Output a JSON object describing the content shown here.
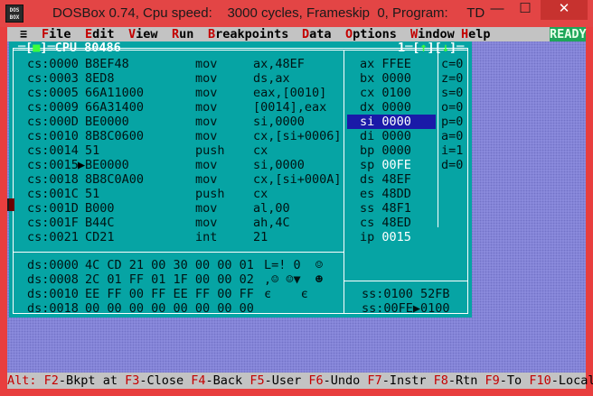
{
  "window": {
    "title": "DOSBox 0.74, Cpu speed:    3000 cycles, Frameskip  0, Program:     TD",
    "icon_label": "DOS BOX",
    "min_glyph": "—",
    "max_glyph": "☐",
    "close_glyph": "✕"
  },
  "menubar": {
    "sys": "≡",
    "items": [
      {
        "hk": "F",
        "rest": "ile"
      },
      {
        "hk": "E",
        "rest": "dit"
      },
      {
        "hk": "V",
        "rest": "iew"
      },
      {
        "hk": "R",
        "rest": "un"
      },
      {
        "hk": "B",
        "rest": "reakpoints"
      },
      {
        "hk": "D",
        "rest": "ata"
      },
      {
        "hk": "O",
        "rest": "ptions"
      },
      {
        "hk": "W",
        "rest": "indow"
      },
      {
        "hk": "H",
        "rest": "elp"
      }
    ],
    "status": "READY"
  },
  "cpu": {
    "title_left": "═[",
    "title_mark": "■",
    "title_mid": "]═CPU 80486",
    "title_right": "1═[",
    "title_up": "↑",
    "title_sep": "][",
    "title_down": "↓",
    "title_end": "]═",
    "code": [
      {
        "addr": "cs:0000",
        "ptr": " ",
        "bytes": "B8EF48",
        "mn": "mov",
        "op": "ax,48EF"
      },
      {
        "addr": "cs:0003",
        "ptr": " ",
        "bytes": "8ED8",
        "mn": "mov",
        "op": "ds,ax"
      },
      {
        "addr": "cs:0005",
        "ptr": " ",
        "bytes": "66A11000",
        "mn": "mov",
        "op": "eax,[0010]"
      },
      {
        "addr": "cs:0009",
        "ptr": " ",
        "bytes": "66A31400",
        "mn": "mov",
        "op": "[0014],eax"
      },
      {
        "addr": "cs:000D",
        "ptr": " ",
        "bytes": "BE0000",
        "mn": "mov",
        "op": "si,0000"
      },
      {
        "addr": "cs:0010",
        "ptr": " ",
        "bytes": "8B8C0600",
        "mn": "mov",
        "op": "cx,[si+0006]"
      },
      {
        "addr": "cs:0014",
        "ptr": " ",
        "bytes": "51",
        "mn": "push",
        "op": "cx"
      },
      {
        "addr": "cs:0015",
        "ptr": "▶",
        "bytes": "BE0000",
        "mn": "mov",
        "op": "si,0000"
      },
      {
        "addr": "cs:0018",
        "ptr": " ",
        "bytes": "8B8C0A00",
        "mn": "mov",
        "op": "cx,[si+000A]"
      },
      {
        "addr": "cs:001C",
        "ptr": " ",
        "bytes": "51",
        "mn": "push",
        "op": "cx"
      },
      {
        "addr": "cs:001D",
        "ptr": " ",
        "bytes": "B000",
        "mn": "mov",
        "op": "al,00"
      },
      {
        "addr": "cs:001F",
        "ptr": " ",
        "bytes": "B44C",
        "mn": "mov",
        "op": "ah,4C"
      },
      {
        "addr": "cs:0021",
        "ptr": " ",
        "bytes": "CD21",
        "mn": "int",
        "op": "21"
      }
    ],
    "registers": [
      {
        "name": "ax",
        "value": "FFEE"
      },
      {
        "name": "bx",
        "value": "0000"
      },
      {
        "name": "cx",
        "value": "0100"
      },
      {
        "name": "dx",
        "value": "0000"
      },
      {
        "name": "si",
        "value": "0000",
        "selected": true
      },
      {
        "name": "di",
        "value": "0000"
      },
      {
        "name": "bp",
        "value": "0000"
      },
      {
        "name": "sp",
        "value": "00FE"
      },
      {
        "name": "ds",
        "value": "48EF"
      },
      {
        "name": "es",
        "value": "48DD"
      },
      {
        "name": "ss",
        "value": "48F1"
      },
      {
        "name": "cs",
        "value": "48ED"
      },
      {
        "name": "ip",
        "value": "0015"
      }
    ],
    "flags": [
      {
        "name": "c",
        "value": "0"
      },
      {
        "name": "z",
        "value": "0"
      },
      {
        "name": "s",
        "value": "0"
      },
      {
        "name": "o",
        "value": "0"
      },
      {
        "name": "p",
        "value": "0"
      },
      {
        "name": "a",
        "value": "0"
      },
      {
        "name": "i",
        "value": "1"
      },
      {
        "name": "d",
        "value": "0"
      }
    ],
    "dump": [
      {
        "addr": "ds:0000",
        "bytes": "4C CD 21 00 30 00 00 01",
        "ascii": "L=! 0  ☺"
      },
      {
        "addr": "ds:0008",
        "bytes": "2C 01 FF 01 1F 00 00 02",
        "ascii": ",☺ ☺▼  ☻"
      },
      {
        "addr": "ds:0010",
        "bytes": "EE FF 00 FF EE FF 00 FF",
        "ascii": "є    є"
      },
      {
        "addr": "ds:0018",
        "bytes": "00 00 00 00 00 00 00 00",
        "ascii": ""
      }
    ],
    "stack": [
      {
        "addr": "ss:0100",
        "ptr": " ",
        "value": "52FB"
      },
      {
        "addr": "ss:00FE",
        "ptr": "▶",
        "value": "0100"
      }
    ]
  },
  "statusbar": [
    {
      "key": "Alt:",
      "label": ""
    },
    {
      "key": "F2",
      "label": "-Bkpt at"
    },
    {
      "key": "F3",
      "label": "-Close"
    },
    {
      "key": "F4",
      "label": "-Back"
    },
    {
      "key": "F5",
      "label": "-User"
    },
    {
      "key": "F6",
      "label": "-Undo"
    },
    {
      "key": "F7",
      "label": "-Instr"
    },
    {
      "key": "F8",
      "label": "-Rtn"
    },
    {
      "key": "F9",
      "label": "-To"
    },
    {
      "key": "F10",
      "label": "-Local"
    }
  ],
  "colors": {
    "menu_bg": "#c3c3c3",
    "hotkey": "#c40000",
    "cpu_bg": "#06a4a4",
    "desktop": "#8f8fe0",
    "ready_bg": "#1ea65a",
    "selection": "#1a1aa8",
    "title_bar": "#e34545"
  }
}
